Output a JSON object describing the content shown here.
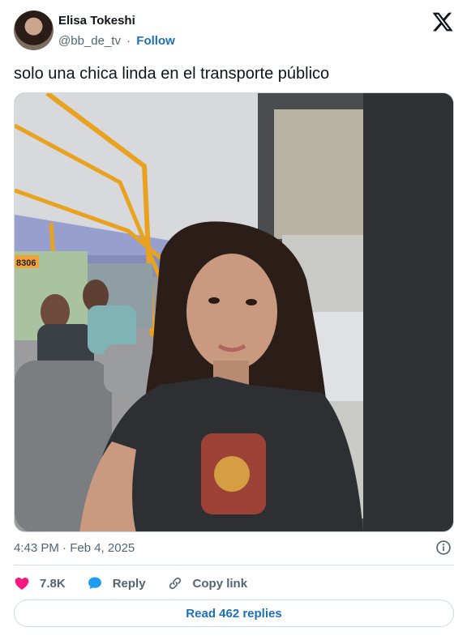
{
  "author": {
    "name": "Elisa Tokeshi",
    "handle": "@bb_de_tv",
    "separator": "·",
    "follow_label": "Follow"
  },
  "tweet": {
    "text": "solo una chica linda en el transporte público",
    "photo_sign": "8306",
    "timestamp": "4:43 PM · Feb 4, 2025"
  },
  "actions": {
    "like_count": "7.8K",
    "reply_label": "Reply",
    "copy_link_label": "Copy link"
  },
  "read_replies_label": "Read 462 replies",
  "colors": {
    "like": "#f91880",
    "reply": "#1d9bf0",
    "link": "#1d70b8",
    "muted": "#536471"
  },
  "icons": {
    "brand": "x-logo-icon",
    "info": "info-icon",
    "like": "heart-icon",
    "reply": "speech-bubble-icon",
    "copy_link": "link-icon"
  }
}
